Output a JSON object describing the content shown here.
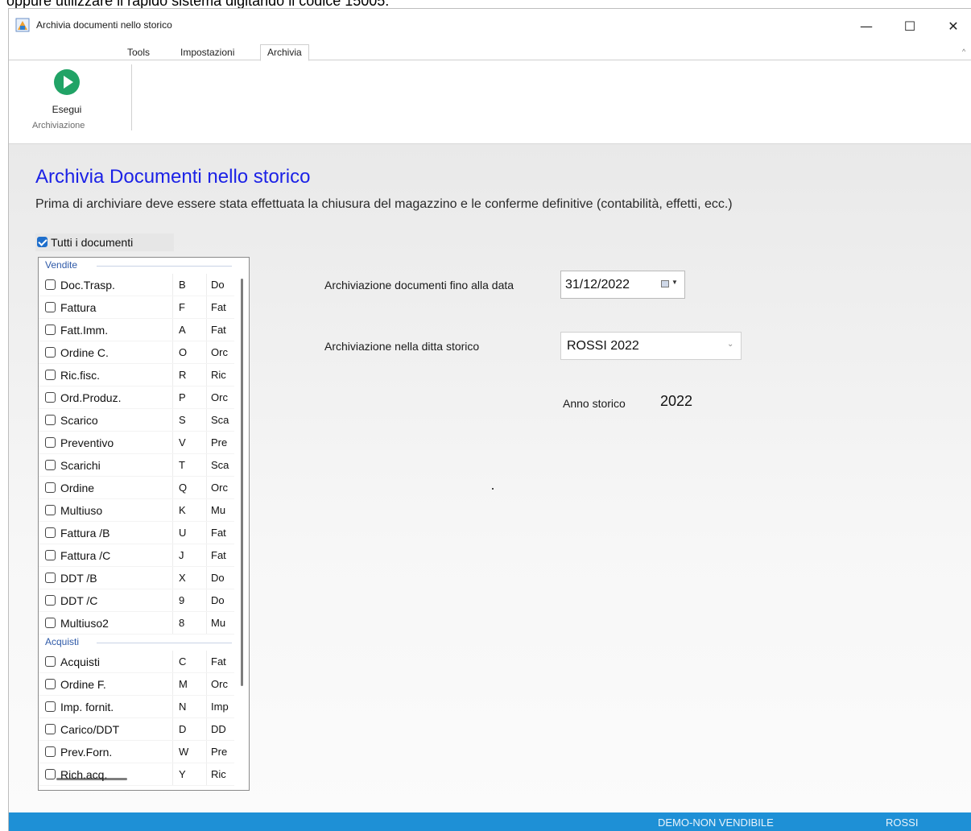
{
  "cropped_caption": "oppure utilizzare il rapido sistema digitando il codice 15005.",
  "window": {
    "title": "Archivia documenti nello storico",
    "controls": [
      "—",
      "☐",
      "✕"
    ]
  },
  "tabs": [
    {
      "label": "Tools",
      "active": false
    },
    {
      "label": "Impostazioni",
      "active": false
    },
    {
      "label": "Archivia",
      "active": true
    }
  ],
  "ribbon": {
    "execute_label": "Esegui",
    "group_label": "Archiviazione"
  },
  "main": {
    "heading": "Archivia Documenti nello storico",
    "subheading": "Prima di archiviare deve essere stata effettuata la chiusura del magazzino e le conferme definitive (contabilità, effetti, ecc.)",
    "all_docs_label": "Tutti i documenti",
    "all_docs_checked": true
  },
  "document_groups": [
    {
      "title": "Vendite",
      "rows": [
        {
          "name": "Doc.Trasp.",
          "code": "B",
          "desc": "Do",
          "checked": false
        },
        {
          "name": "Fattura",
          "code": "F",
          "desc": "Fat",
          "checked": false
        },
        {
          "name": "Fatt.Imm.",
          "code": "A",
          "desc": "Fat",
          "checked": false
        },
        {
          "name": "Ordine C.",
          "code": "O",
          "desc": "Orc",
          "checked": false
        },
        {
          "name": "Ric.fisc.",
          "code": "R",
          "desc": "Ric",
          "checked": false
        },
        {
          "name": "Ord.Produz.",
          "code": "P",
          "desc": "Orc",
          "checked": false
        },
        {
          "name": "Scarico",
          "code": "S",
          "desc": "Sca",
          "checked": false
        },
        {
          "name": "Preventivo",
          "code": "V",
          "desc": "Pre",
          "checked": false
        },
        {
          "name": "Scarichi",
          "code": "T",
          "desc": "Sca",
          "checked": false
        },
        {
          "name": "Ordine",
          "code": "Q",
          "desc": "Orc",
          "checked": false
        },
        {
          "name": "Multiuso",
          "code": "K",
          "desc": "Mu",
          "checked": false
        },
        {
          "name": "Fattura /B",
          "code": "U",
          "desc": "Fat",
          "checked": false
        },
        {
          "name": "Fattura /C",
          "code": "J",
          "desc": "Fat",
          "checked": false
        },
        {
          "name": "DDT /B",
          "code": "X",
          "desc": "Do",
          "checked": false
        },
        {
          "name": "DDT /C",
          "code": "9",
          "desc": "Do",
          "checked": false
        },
        {
          "name": "Multiuso2",
          "code": "8",
          "desc": "Mu",
          "checked": false
        }
      ]
    },
    {
      "title": "Acquisti",
      "rows": [
        {
          "name": "Acquisti",
          "code": "C",
          "desc": "Fat",
          "checked": false
        },
        {
          "name": "Ordine F.",
          "code": "M",
          "desc": "Orc",
          "checked": false
        },
        {
          "name": "Imp. fornit.",
          "code": "N",
          "desc": "Imp",
          "checked": false
        },
        {
          "name": "Carico/DDT",
          "code": "D",
          "desc": "DD",
          "checked": false
        },
        {
          "name": "Prev.Forn.",
          "code": "W",
          "desc": "Pre",
          "checked": false
        },
        {
          "name": "Rich.acq.",
          "code": "Y",
          "desc": "Ric",
          "checked": false
        }
      ]
    }
  ],
  "form": {
    "date_label": "Archiviazione documenti fino alla data",
    "date_value": "31/12/2022",
    "company_label": "Archiviazione nella ditta storico",
    "company_value": "ROSSI 2022",
    "year_label": "Anno storico",
    "year_value": "2022"
  },
  "statusbar": {
    "demo": "DEMO-NON VENDIBILE",
    "user": "ROSSI"
  },
  "colors": {
    "heading": "#1c22e6",
    "statusbar": "#1e90d6",
    "execute_icon": "#21a366",
    "group_header": "#2f5aa8",
    "checkbox_checked": "#1f6fcc"
  }
}
